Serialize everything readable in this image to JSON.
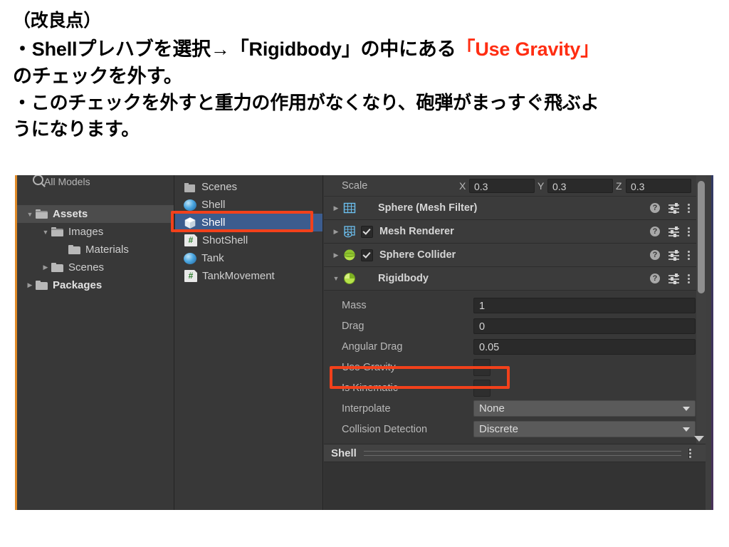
{
  "slide": {
    "heading": "（改良点）",
    "bullet1_part1": "・Shellプレハブを選択→「Rigidbody」の中にある",
    "bullet1_accent": "「Use Gravity」",
    "bullet1_part2": "のチェックを外す。",
    "bullet2_line1": "・このチェックを外すと重力の作用がなくなり、砲弾がまっすぐ飛ぶよ",
    "bullet2_line2": "うになります。",
    "accent_color": "#ff2d12"
  },
  "unity": {
    "project_panel": {
      "search_label": "All Models",
      "tree": [
        {
          "label": "Assets",
          "arrow": "▼",
          "indent": 0,
          "bold": true,
          "highlight": true,
          "folder": "open"
        },
        {
          "label": "Images",
          "arrow": "▼",
          "indent": 1,
          "bold": false,
          "highlight": false,
          "folder": "open"
        },
        {
          "label": "Materials",
          "arrow": "",
          "indent": 2,
          "bold": false,
          "highlight": false,
          "folder": "closed"
        },
        {
          "label": "Scenes",
          "arrow": "▶",
          "indent": 1,
          "bold": false,
          "highlight": false,
          "folder": "closed"
        },
        {
          "label": "Packages",
          "arrow": "▶",
          "indent": 0,
          "bold": true,
          "highlight": false,
          "folder": "closed"
        }
      ]
    },
    "asset_list": [
      {
        "label": "Scenes",
        "icon": "folder-icon",
        "selected": false
      },
      {
        "label": "Shell",
        "icon": "material-icon",
        "selected": false
      },
      {
        "label": "Shell",
        "icon": "prefab-icon",
        "selected": true
      },
      {
        "label": "ShotShell",
        "icon": "script-icon",
        "selected": false
      },
      {
        "label": "Tank",
        "icon": "material-icon",
        "selected": false
      },
      {
        "label": "TankMovement",
        "icon": "script-icon",
        "selected": false
      }
    ],
    "inspector": {
      "scale_row": {
        "label": "Scale",
        "axes": [
          {
            "letter": "X",
            "value": "0.3"
          },
          {
            "letter": "Y",
            "value": "0.3"
          },
          {
            "letter": "Z",
            "value": "0.3"
          }
        ]
      },
      "components": [
        {
          "title": "Sphere (Mesh Filter)",
          "fold": "▶",
          "icon": "mesh-filter-icon",
          "has_checkbox": false,
          "checked": false
        },
        {
          "title": "Mesh Renderer",
          "fold": "▶",
          "icon": "mesh-renderer-icon",
          "has_checkbox": true,
          "checked": true
        },
        {
          "title": "Sphere Collider",
          "fold": "▶",
          "icon": "sphere-collider-icon",
          "has_checkbox": true,
          "checked": true
        },
        {
          "title": "Rigidbody",
          "fold": "▼",
          "icon": "rigidbody-icon",
          "has_checkbox": false,
          "checked": false
        }
      ],
      "rigidbody_properties": [
        {
          "label": "Mass",
          "type": "field",
          "value": "1"
        },
        {
          "label": "Drag",
          "type": "field",
          "value": "0"
        },
        {
          "label": "Angular Drag",
          "type": "field",
          "value": "0.05"
        },
        {
          "label": "Use Gravity",
          "type": "checkbox",
          "value": "",
          "checked": false,
          "highlighted": true
        },
        {
          "label": "Is Kinematic",
          "type": "checkbox",
          "value": "",
          "checked": false,
          "highlighted": false
        },
        {
          "label": "Interpolate",
          "type": "dropdown",
          "value": "None"
        },
        {
          "label": "Collision Detection",
          "type": "dropdown",
          "value": "Discrete"
        }
      ],
      "footer_title": "Shell"
    },
    "annotation_color": "#f2411b",
    "selection_color": "#3c5c8e"
  }
}
